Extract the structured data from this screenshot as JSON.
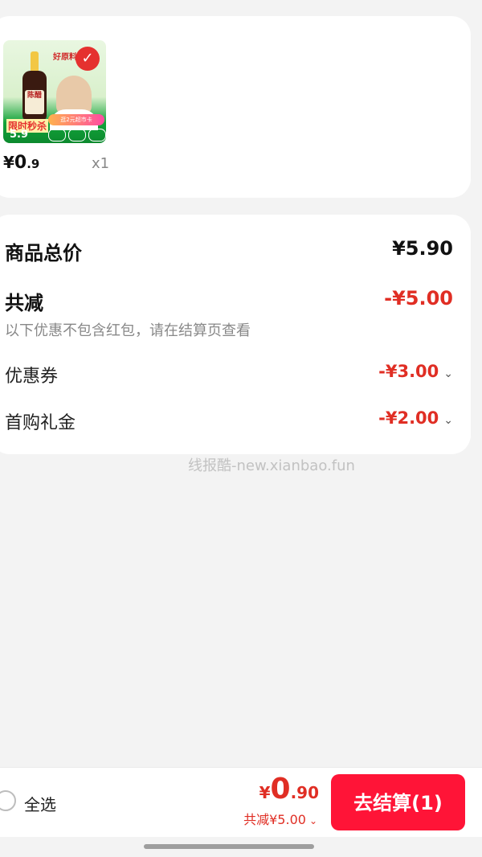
{
  "product": {
    "thumbnail_alt": "陈醋",
    "thumb_texts": {
      "top_slogan": "好原料",
      "bottle_label": "陈醋",
      "flash_sale": "限时秒杀",
      "promo": "逛2元超市卡",
      "bottle_price": "5.9"
    },
    "selected": true,
    "price_symbol": "¥",
    "price_int": "0",
    "price_dec": ".9",
    "quantity": "x1"
  },
  "summary": {
    "total_label": "商品总价",
    "total_value": "¥5.90",
    "reduce_label": "共减",
    "reduce_value": "-¥5.00",
    "note": "以下优惠不包含红包，请在结算页查看",
    "coupon_label": "优惠券",
    "coupon_value": "-¥3.00",
    "first_buy_label": "首购礼金",
    "first_buy_value": "-¥2.00"
  },
  "watermark": "线报酷-new.xianbao.fun",
  "bottom_bar": {
    "select_all": "全选",
    "pay_symbol": "¥",
    "pay_int": "0",
    "pay_dec": ".90",
    "discount_text": "共减¥5.00",
    "checkout_label": "去结算(1)"
  },
  "colors": {
    "accent": "#e02e24",
    "checkout_button": "#ff1437",
    "background": "#f3f3f3"
  },
  "icons": {
    "selected_check": "check-icon",
    "expand": "chevron-down-icon"
  }
}
